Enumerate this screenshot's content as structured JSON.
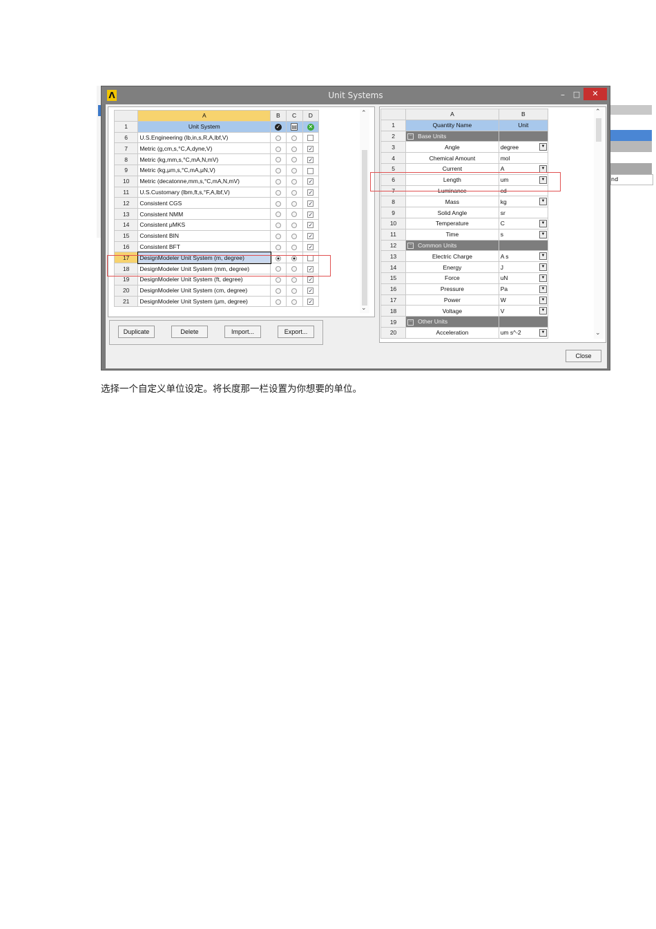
{
  "window": {
    "title": "Unit Systems",
    "minimize": "–",
    "maximize": "□",
    "close": "✕",
    "logo": "Λ"
  },
  "left_table": {
    "headers": [
      "A",
      "B",
      "C",
      "D"
    ],
    "header_row": {
      "num": "1",
      "name": "Unit System"
    },
    "rows": [
      {
        "num": "6",
        "name": "U.S.Engineering (lb,in,s,R,A,lbf,V)",
        "b": false,
        "c": false,
        "d": false
      },
      {
        "num": "7",
        "name": "Metric (g,cm,s,°C,A,dyne,V)",
        "b": false,
        "c": false,
        "d": true
      },
      {
        "num": "8",
        "name": "Metric (kg,mm,s,°C,mA,N,mV)",
        "b": false,
        "c": false,
        "d": true
      },
      {
        "num": "9",
        "name": "Metric (kg,μm,s,°C,mA,μN,V)",
        "b": false,
        "c": false,
        "d": false
      },
      {
        "num": "10",
        "name": "Metric (decatonne,mm,s,°C,mA,N,mV)",
        "b": false,
        "c": false,
        "d": true
      },
      {
        "num": "11",
        "name": "U.S.Customary (lbm,ft,s,°F,A,lbf,V)",
        "b": false,
        "c": false,
        "d": true
      },
      {
        "num": "12",
        "name": "Consistent CGS",
        "b": false,
        "c": false,
        "d": true
      },
      {
        "num": "13",
        "name": "Consistent NMM",
        "b": false,
        "c": false,
        "d": true
      },
      {
        "num": "14",
        "name": "Consistent μMKS",
        "b": false,
        "c": false,
        "d": true
      },
      {
        "num": "15",
        "name": "Consistent BIN",
        "b": false,
        "c": false,
        "d": true
      },
      {
        "num": "16",
        "name": "Consistent BFT",
        "b": false,
        "c": false,
        "d": true
      },
      {
        "num": "17",
        "name": "DesignModeler Unit System (m, degree)",
        "b": true,
        "c": true,
        "d": false,
        "selected": true
      },
      {
        "num": "18",
        "name": "DesignModeler Unit System (mm, degree)",
        "b": false,
        "c": false,
        "d": true
      },
      {
        "num": "19",
        "name": "DesignModeler Unit System (ft, degree)",
        "b": false,
        "c": false,
        "d": true
      },
      {
        "num": "20",
        "name": "DesignModeler Unit System (cm, degree)",
        "b": false,
        "c": false,
        "d": true
      },
      {
        "num": "21",
        "name": "DesignModeler Unit System (μm, degree)",
        "b": false,
        "c": false,
        "d": true
      }
    ]
  },
  "buttons": {
    "duplicate": "Duplicate",
    "delete": "Delete",
    "import": "Import...",
    "export": "Export...",
    "close": "Close"
  },
  "right_table": {
    "headers": [
      "A",
      "B"
    ],
    "rows": [
      {
        "num": "1",
        "name": "Quantity Name",
        "unit": "Unit",
        "kind": "header"
      },
      {
        "num": "2",
        "name": "Base Units",
        "kind": "group"
      },
      {
        "num": "3",
        "name": "Angle",
        "unit": "degree",
        "dropdown": true
      },
      {
        "num": "4",
        "name": "Chemical Amount",
        "unit": "mol",
        "dropdown": false
      },
      {
        "num": "5",
        "name": "Current",
        "unit": "A",
        "dropdown": true
      },
      {
        "num": "6",
        "name": "Length",
        "unit": "um",
        "dropdown": true
      },
      {
        "num": "7",
        "name": "Luminance",
        "unit": "cd",
        "dropdown": false
      },
      {
        "num": "8",
        "name": "Mass",
        "unit": "kg",
        "dropdown": true
      },
      {
        "num": "9",
        "name": "Solid Angle",
        "unit": "sr",
        "dropdown": false
      },
      {
        "num": "10",
        "name": "Temperature",
        "unit": "C",
        "dropdown": true
      },
      {
        "num": "11",
        "name": "Time",
        "unit": "s",
        "dropdown": true
      },
      {
        "num": "12",
        "name": "Common Units",
        "kind": "group"
      },
      {
        "num": "13",
        "name": "Electric Charge",
        "unit": "A s",
        "dropdown": true
      },
      {
        "num": "14",
        "name": "Energy",
        "unit": "J",
        "dropdown": true
      },
      {
        "num": "15",
        "name": "Force",
        "unit": "uN",
        "dropdown": true
      },
      {
        "num": "16",
        "name": "Pressure",
        "unit": "Pa",
        "dropdown": true
      },
      {
        "num": "17",
        "name": "Power",
        "unit": "W",
        "dropdown": true
      },
      {
        "num": "18",
        "name": "Voltage",
        "unit": "V",
        "dropdown": true
      },
      {
        "num": "19",
        "name": "Other Units",
        "kind": "group"
      },
      {
        "num": "20",
        "name": "Acceleration",
        "unit": "um s^-2",
        "dropdown": true
      }
    ]
  },
  "background_right": {
    "text": "nd"
  },
  "caption": "选择一个自定义单位设定。将长度那一栏设置为你想要的单位。",
  "colors": {
    "title_bar": "#7f7f7f",
    "close_red": "#c7302f",
    "column_header": "#f7d36e",
    "row_header_blue": "#a8c8ec",
    "highlight_box": "#e05050",
    "group_row": "#7d7d7d"
  }
}
